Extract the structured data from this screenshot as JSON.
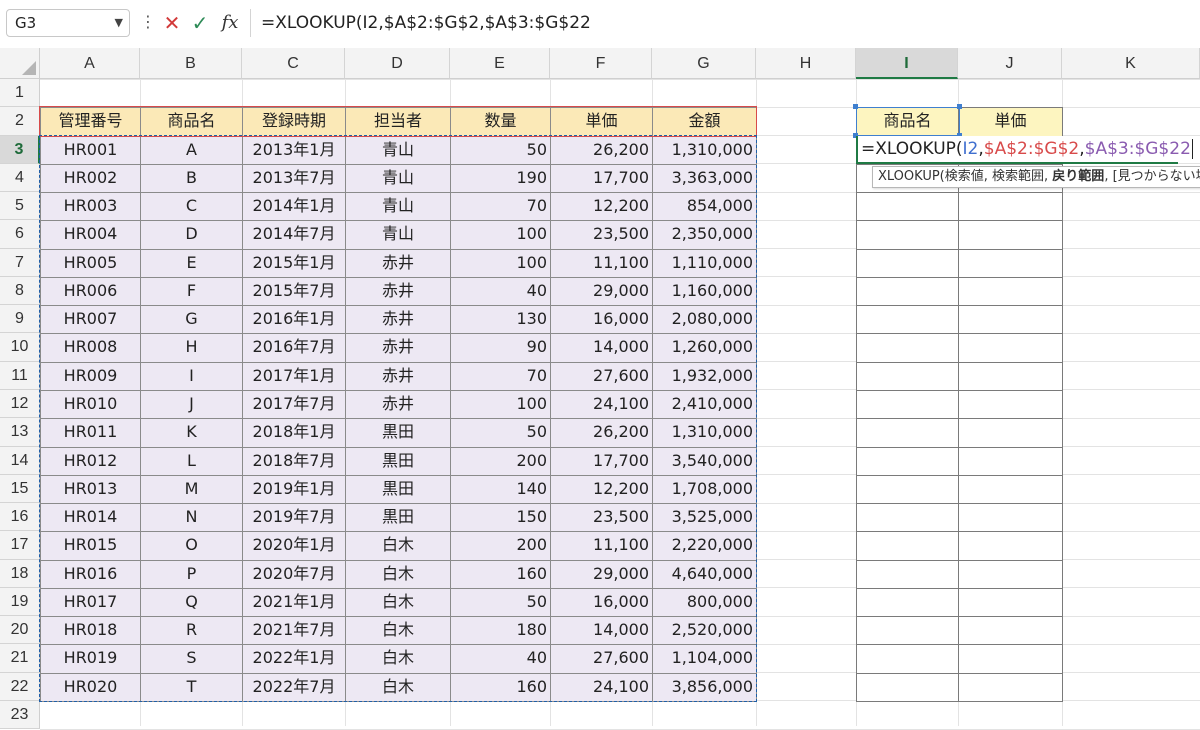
{
  "formula_bar": {
    "name_box": "G3",
    "name_box_arrow": "chevron-down-icon",
    "more_icon": "more-vertical-icon",
    "cancel_icon": "cancel-x-icon",
    "enter_icon": "enter-check-icon",
    "fx_label": "fx",
    "formula": "=XLOOKUP(I2,$A$2:$G$2,$A$3:$G$22"
  },
  "columns": [
    "A",
    "B",
    "C",
    "D",
    "E",
    "F",
    "G",
    "H",
    "I",
    "J",
    "K"
  ],
  "active_column": "I",
  "rows": [
    "1",
    "2",
    "3",
    "4",
    "5",
    "6",
    "7",
    "8",
    "9",
    "10",
    "11",
    "12",
    "13",
    "14",
    "15",
    "16",
    "17",
    "18",
    "19",
    "20",
    "21",
    "22",
    "23"
  ],
  "active_row": "3",
  "table": {
    "headers": [
      "管理番号",
      "商品名",
      "登録時期",
      "担当者",
      "数量",
      "単価",
      "金額"
    ],
    "data": [
      [
        "HR001",
        "A",
        "2013年1月",
        "青山",
        "50",
        "26,200",
        "1,310,000"
      ],
      [
        "HR002",
        "B",
        "2013年7月",
        "青山",
        "190",
        "17,700",
        "3,363,000"
      ],
      [
        "HR003",
        "C",
        "2014年1月",
        "青山",
        "70",
        "12,200",
        "854,000"
      ],
      [
        "HR004",
        "D",
        "2014年7月",
        "青山",
        "100",
        "23,500",
        "2,350,000"
      ],
      [
        "HR005",
        "E",
        "2015年1月",
        "赤井",
        "100",
        "11,100",
        "1,110,000"
      ],
      [
        "HR006",
        "F",
        "2015年7月",
        "赤井",
        "40",
        "29,000",
        "1,160,000"
      ],
      [
        "HR007",
        "G",
        "2016年1月",
        "赤井",
        "130",
        "16,000",
        "2,080,000"
      ],
      [
        "HR008",
        "H",
        "2016年7月",
        "赤井",
        "90",
        "14,000",
        "1,260,000"
      ],
      [
        "HR009",
        "I",
        "2017年1月",
        "赤井",
        "70",
        "27,600",
        "1,932,000"
      ],
      [
        "HR010",
        "J",
        "2017年7月",
        "赤井",
        "100",
        "24,100",
        "2,410,000"
      ],
      [
        "HR011",
        "K",
        "2018年1月",
        "黒田",
        "50",
        "26,200",
        "1,310,000"
      ],
      [
        "HR012",
        "L",
        "2018年7月",
        "黒田",
        "200",
        "17,700",
        "3,540,000"
      ],
      [
        "HR013",
        "M",
        "2019年1月",
        "黒田",
        "140",
        "12,200",
        "1,708,000"
      ],
      [
        "HR014",
        "N",
        "2019年7月",
        "黒田",
        "150",
        "23,500",
        "3,525,000"
      ],
      [
        "HR015",
        "O",
        "2020年1月",
        "白木",
        "200",
        "11,100",
        "2,220,000"
      ],
      [
        "HR016",
        "P",
        "2020年7月",
        "白木",
        "160",
        "29,000",
        "4,640,000"
      ],
      [
        "HR017",
        "Q",
        "2021年1月",
        "白木",
        "50",
        "16,000",
        "800,000"
      ],
      [
        "HR018",
        "R",
        "2021年7月",
        "白木",
        "180",
        "14,000",
        "2,520,000"
      ],
      [
        "HR019",
        "S",
        "2022年1月",
        "白木",
        "40",
        "27,600",
        "1,104,000"
      ],
      [
        "HR020",
        "T",
        "2022年7月",
        "白木",
        "160",
        "24,100",
        "3,856,000"
      ]
    ]
  },
  "lookup": {
    "headers": [
      "商品名",
      "単価"
    ]
  },
  "edit_cell": {
    "part1": "=XLOOKUP(",
    "arg1": "I2",
    "sep1": ",",
    "arg2": "$A$2:$G$2",
    "sep2": ",",
    "arg3": "$A$3:$G$22"
  },
  "tooltip": {
    "prefix": "XLOOKUP(検索値, 検索範囲, ",
    "bold": "戻り範囲",
    "suffix": ", [見つからない場合]"
  },
  "colors": {
    "header_fill": "#fbe9b7",
    "data_fill": "#ede8f3",
    "lookup_header_fill": "#fdf5c0",
    "arg1_color": "#3f6fcf",
    "arg2_color": "#d84a4a",
    "arg3_color": "#8a5bb0",
    "active_green": "#1f7a44"
  }
}
